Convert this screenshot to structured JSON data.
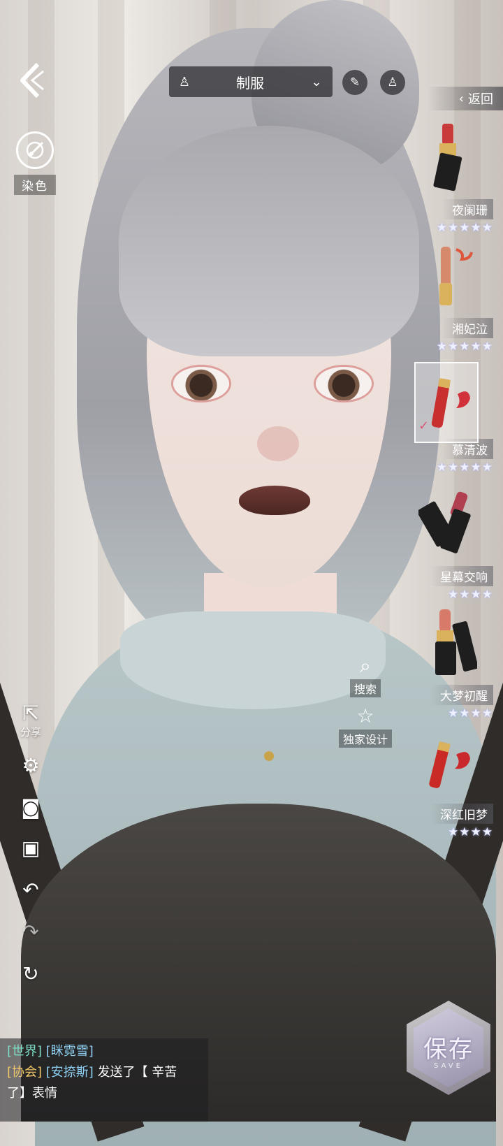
{
  "top_bar": {
    "outfit_label": "制服",
    "dress_icon": "dress-icon",
    "dropdown_icon": "chevron-down-icon",
    "return_label": "返回"
  },
  "left_panel": {
    "dye_label": "染色",
    "share_label": "分享"
  },
  "makeup_items": [
    {
      "name": "夜阑珊",
      "stars": "★★★★★",
      "selected": false
    },
    {
      "name": "湘妃泣",
      "stars": "★★★★★",
      "selected": false
    },
    {
      "name": "慕清波",
      "stars": "★★★★★",
      "selected": true
    },
    {
      "name": "星幕交响",
      "stars": "★★★★",
      "selected": false
    },
    {
      "name": "大梦初醒",
      "stars": "★★★★",
      "selected": false
    },
    {
      "name": "深红旧梦",
      "stars": "★★★★",
      "selected": false
    }
  ],
  "actions": {
    "search_label": "搜索",
    "exclusive_label": "独家设计",
    "save_label": "保存",
    "save_sub": "SAVE"
  },
  "chat": {
    "line1_channel": "[世界]",
    "line1_user": "[眯霓雪]",
    "line2_channel": "[协会]",
    "line2_user": "[安捺斯]",
    "line2_msg_a": "发送了【 辛苦",
    "line2_msg_b": "了】表情"
  },
  "colors": {
    "accent_world": "#7ee0c8",
    "accent_guild": "#f0c86a",
    "username": "#8ed0f2"
  }
}
